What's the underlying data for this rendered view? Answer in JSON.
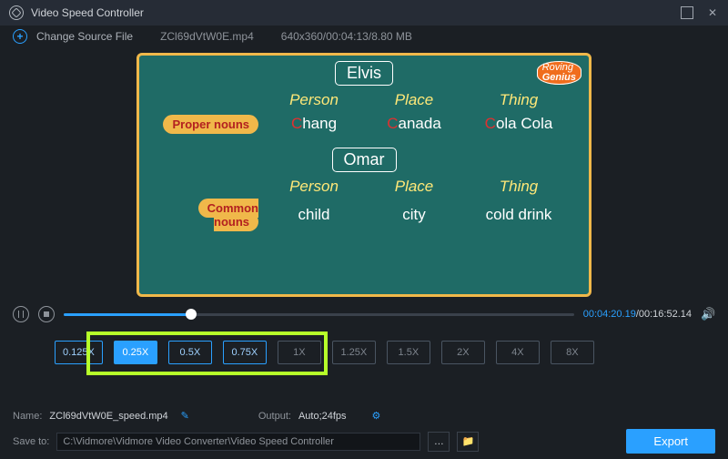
{
  "title": "Video Speed Controller",
  "filebar": {
    "change_source": "Change Source File",
    "filename": "ZCl69dVtW0E.mp4",
    "fileinfo": "640x360/00:04:13/8.80 MB"
  },
  "video": {
    "logo_top": "Roving",
    "logo_bottom": "Genius",
    "name1": "Elvis",
    "name2": "Omar",
    "col_person": "Person",
    "col_place": "Place",
    "col_thing": "Thing",
    "proper_label": "Proper nouns",
    "common_label": "Common nouns",
    "r1": {
      "person_c": "C",
      "person_rest": "hang",
      "place_c": "C",
      "place_rest": "anada",
      "thing_c": "C",
      "thing_rest": "ola Cola"
    },
    "r2": {
      "person": "child",
      "place": "city",
      "thing": "cold drink"
    }
  },
  "playback": {
    "current": "00:04:20.19",
    "total": "/00:16:52.14"
  },
  "speeds": {
    "s0": "0.125X",
    "s1": "0.25X",
    "s2": "0.5X",
    "s3": "0.75X",
    "s4": "1X",
    "s5": "1.25X",
    "s6": "1.5X",
    "s7": "2X",
    "s8": "4X",
    "s9": "8X"
  },
  "bottom": {
    "name_label": "Name:",
    "name_value": "ZCl69dVtW0E_speed.mp4",
    "output_label": "Output:",
    "output_value": "Auto;24fps",
    "saveto_label": "Save to:",
    "saveto_value": "C:\\Vidmore\\Vidmore Video Converter\\Video Speed Controller",
    "export": "Export"
  }
}
